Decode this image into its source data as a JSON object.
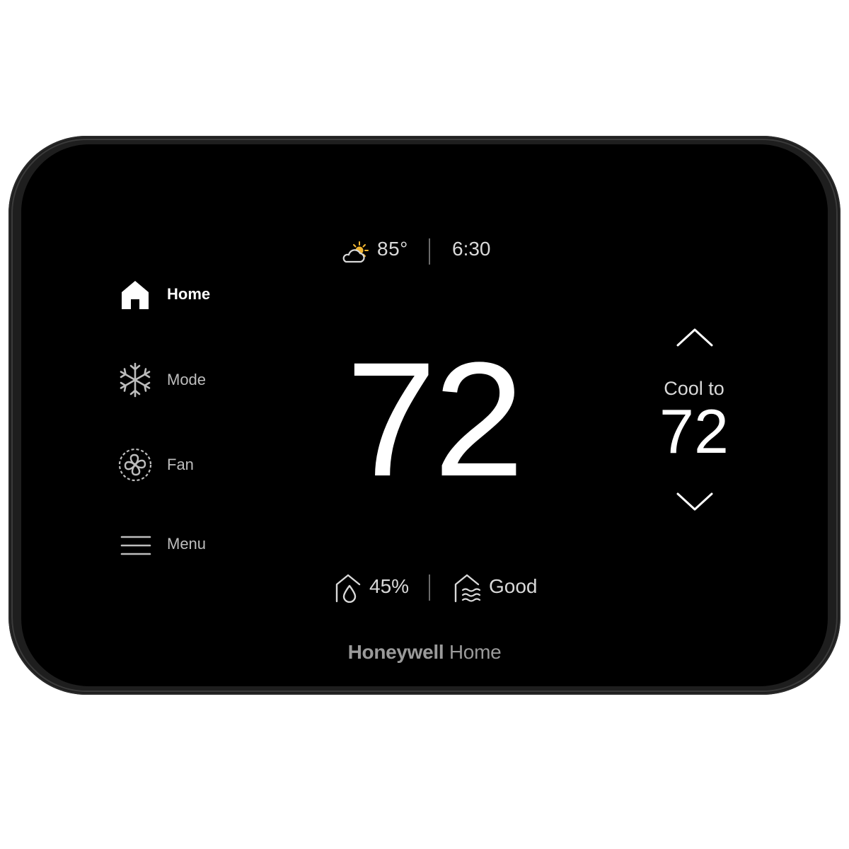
{
  "status_bar": {
    "weather_icon": "partly-sunny-icon",
    "outdoor_temp": "85°",
    "time": "6:30"
  },
  "sidebar": {
    "items": [
      {
        "label": "Home",
        "icon": "home-icon",
        "active": true
      },
      {
        "label": "Mode",
        "icon": "snowflake-icon",
        "active": false
      },
      {
        "label": "Fan",
        "icon": "fan-icon",
        "active": false
      },
      {
        "label": "Menu",
        "icon": "hamburger-menu-icon",
        "active": false
      }
    ]
  },
  "main": {
    "current_temp": "72"
  },
  "setpoint": {
    "label": "Cool to",
    "value": "72",
    "up_icon": "chevron-up-icon",
    "down_icon": "chevron-down-icon"
  },
  "bottom_bar": {
    "humidity_icon": "humidity-icon",
    "humidity": "45%",
    "air_icon": "air-quality-icon",
    "air_quality": "Good"
  },
  "brand": {
    "primary": "Honeywell",
    "secondary": "Home"
  },
  "colors": {
    "screen": "#000000",
    "bezel": "#1e1e1e",
    "text_primary": "#ffffff",
    "text_secondary": "#d9d9d9",
    "sun_accent": "#f2b632"
  }
}
